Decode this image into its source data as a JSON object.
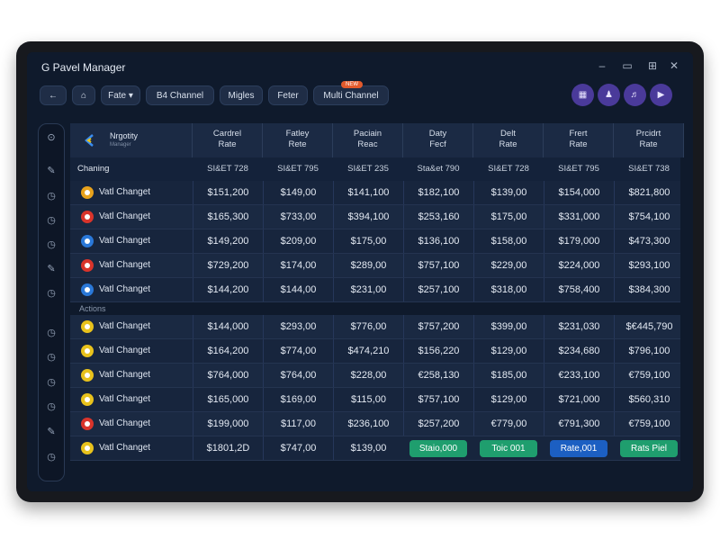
{
  "window": {
    "title": "G Pavel Manager",
    "controls": {
      "minimize": "–",
      "restore": "▭",
      "maximize": "⊞",
      "close": "✕"
    }
  },
  "toolbar": {
    "back_icon": "←",
    "home_icon": "⌂",
    "fate": "Fate ▾",
    "channel": "B4 Channel",
    "migles": "Migles",
    "feter": "Feter",
    "multi_channel": "Multi Channel",
    "multi_badge": "NEW",
    "actions": [
      "▦",
      "♟",
      "♬",
      "▶"
    ]
  },
  "sidebar_icons": [
    "⊙",
    "✎",
    "◷",
    "◷",
    "◷",
    "✎",
    "◷",
    "◷",
    "◷",
    "◷",
    "◷",
    "✎",
    "◷"
  ],
  "table": {
    "logo_title": "Nrgotity",
    "logo_subtitle": "Manager",
    "columns": [
      [
        "Cardrel",
        "Rate"
      ],
      [
        "Fatley",
        "Rete"
      ],
      [
        "Paciain",
        "Reac"
      ],
      [
        "Daty",
        "Fecf"
      ],
      [
        "Delt",
        "Rate"
      ],
      [
        "Frert",
        "Rate"
      ],
      [
        "Prcidrt",
        "Rate"
      ]
    ],
    "band": {
      "label": "Chaning",
      "values": [
        "SI&ET 728",
        "SI&ET 795",
        "SI&ET 235",
        "Sta&et 790",
        "SI&ET 728",
        "SI&ET 795",
        "SI&ET 738"
      ]
    },
    "section_label": "Actions",
    "row_icon_colors": [
      "#e8a21c",
      "#d9342b",
      "#2a78d8",
      "#d9342b",
      "#2a78d8",
      "#e8c21c",
      "#e8c21c",
      "#e8c21c",
      "#e8c21c",
      "#d9342b",
      "#e8c21c"
    ],
    "rows": [
      {
        "name": "Vatl Changet",
        "values": [
          "$151,200",
          "$149,00",
          "$141,100",
          "$182,100",
          "$139,00",
          "$154,000",
          "$821,800"
        ]
      },
      {
        "name": "Vatl Changet",
        "values": [
          "$165,300",
          "$733,00",
          "$394,100",
          "$253,160",
          "$175,00",
          "$331,000",
          "$754,100"
        ]
      },
      {
        "name": "Vatl Changet",
        "values": [
          "$149,200",
          "$209,00",
          "$175,00",
          "$136,100",
          "$158,00",
          "$179,000",
          "$473,300"
        ]
      },
      {
        "name": "Vatl Changet",
        "values": [
          "$729,200",
          "$174,00",
          "$289,00",
          "$757,100",
          "$229,00",
          "$224,000",
          "$293,100"
        ]
      },
      {
        "name": "Vatl Changet",
        "values": [
          "$144,200",
          "$144,00",
          "$231,00",
          "$257,100",
          "$318,00",
          "$758,400",
          "$384,300"
        ]
      },
      {
        "name": "Vatl Changet",
        "values": [
          "$144,000",
          "$293,00",
          "$776,00",
          "$757,200",
          "$399,00",
          "$231,030",
          "$€445,790"
        ]
      },
      {
        "name": "Vatl Changet",
        "values": [
          "$164,200",
          "$774,00",
          "$474,210",
          "$156,220",
          "$129,00",
          "$234,680",
          "$796,100"
        ]
      },
      {
        "name": "Vatl Changet",
        "values": [
          "$764,000",
          "$764,00",
          "$228,00",
          "€258,130",
          "$185,00",
          "€233,100",
          "€759,100"
        ]
      },
      {
        "name": "Vatl Changet",
        "values": [
          "$165,000",
          "$169,00",
          "$115,00",
          "$757,100",
          "$129,00",
          "$721,000",
          "$560,310"
        ]
      },
      {
        "name": "Vatl Changet",
        "values": [
          "$199,000",
          "$117,00",
          "$236,100",
          "$257,200",
          "€779,00",
          "€791,300",
          "€759,100"
        ]
      },
      {
        "name": "Vatl Changet",
        "values": [
          "$1801,2D",
          "$747,00",
          "$139,00"
        ]
      }
    ],
    "last_row_buttons": [
      "Staio,000",
      "Toic 001",
      "Rate,001",
      "Rats Piel"
    ],
    "button_colors": [
      "#1f9e6e",
      "#1f9e6e",
      "#1c5fc2",
      "#1f9e6e"
    ]
  }
}
